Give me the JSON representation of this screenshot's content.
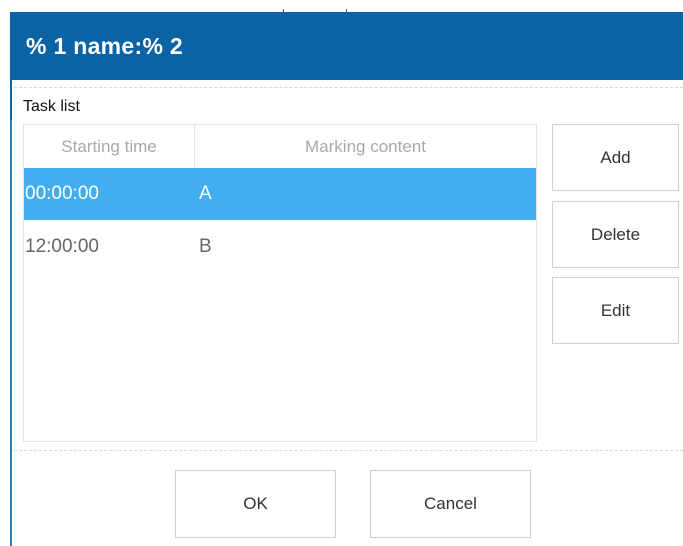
{
  "window": {
    "title": "% 1 name:% 2"
  },
  "task_group": {
    "label": "Task list"
  },
  "table": {
    "columns": [
      "Starting time",
      "Marking content"
    ],
    "rows": [
      {
        "time": "00:00:00",
        "content": "A",
        "selected": true
      },
      {
        "time": "12:00:00",
        "content": "B",
        "selected": false
      }
    ],
    "selected_color": "#41aef0"
  },
  "side_buttons": {
    "add": "Add",
    "delete": "Delete",
    "edit": "Edit"
  },
  "footer": {
    "ok": "OK",
    "cancel": "Cancel"
  },
  "colors": {
    "titlebar": "#0b63a5",
    "selection": "#41aef0"
  }
}
